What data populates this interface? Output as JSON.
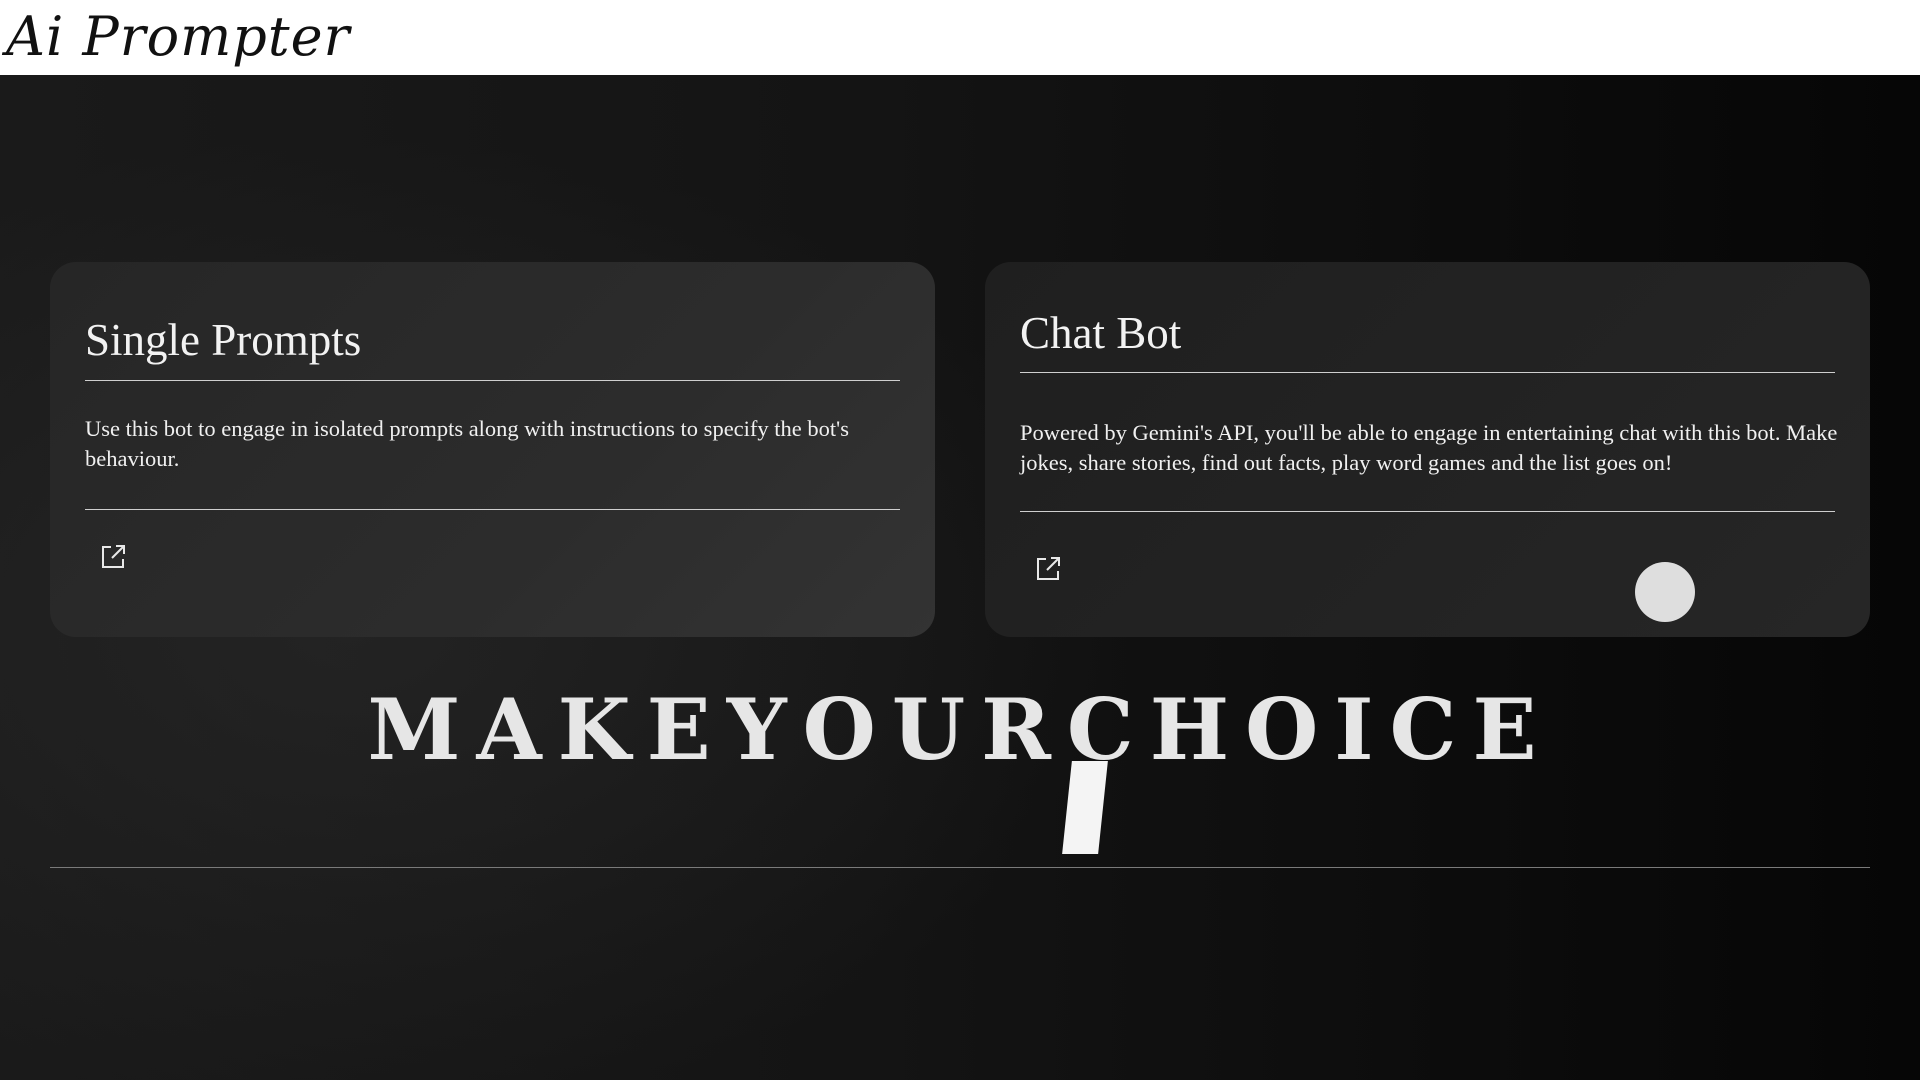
{
  "header": {
    "logo": "Ai Prompter"
  },
  "cards": [
    {
      "title": "Single Prompts",
      "description": "Use this bot to engage in isolated prompts along with instructions to specify the bot's behaviour.",
      "action_icon": "external-link-icon"
    },
    {
      "title": "Chat Bot",
      "description": "Powered by Gemini's API, you'll be able to engage in entertaining chat with this bot. Make jokes, share stories, find out facts, play word games and the list goes on!",
      "action_icon": "external-link-icon"
    }
  ],
  "headline": "MAKEYOURCHOICE",
  "footer": {
    "link_icon": "link-icon"
  },
  "colors": {
    "background_dark": "#141414",
    "card_bg": "#2a2a2a",
    "text_light": "#f0f0f0",
    "header_bg": "#ffffff"
  }
}
